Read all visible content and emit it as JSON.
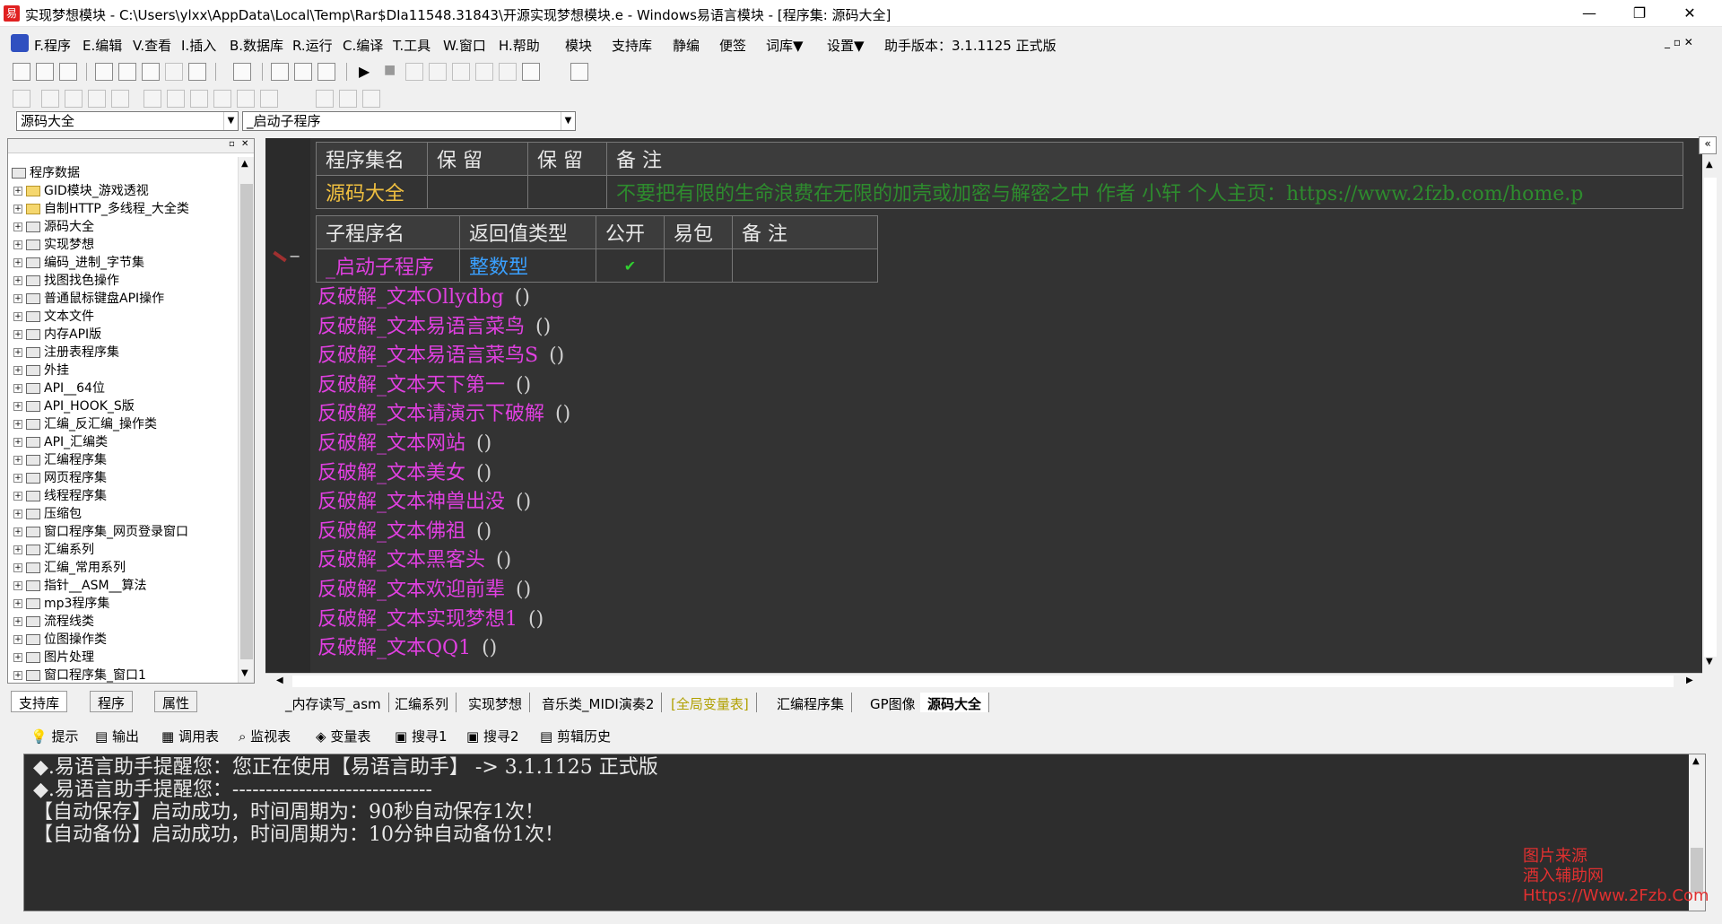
{
  "window": {
    "title": "实现梦想模块 - C:\\Users\\ylxx\\AppData\\Local\\Temp\\Rar$DIa11548.31843\\开源实现梦想模块.e - Windows易语言模块 - [程序集: 源码大全]"
  },
  "menu": [
    "F.程序",
    "E.编辑",
    "V.查看",
    "I.插入",
    "B.数据库",
    "R.运行",
    "C.编译",
    "T.工具",
    "W.窗口",
    "H.帮助",
    "模块",
    "支持库",
    "静编",
    "便签",
    "词库▼",
    "设置▼",
    "助手版本：3.1.1125 正式版"
  ],
  "combos": {
    "left": "源码大全",
    "right": "_启动子程序"
  },
  "tree": {
    "root": "程序数据",
    "items": [
      "GID模块_游戏透视",
      "自制HTTP_多线程_大全类",
      "源码大全",
      "实现梦想",
      "编码_进制_字节集",
      "找图找色操作",
      "普通鼠标键盘API操作",
      "文本文件",
      "内存API版",
      "注册表程序集",
      "外挂",
      "API__64位",
      "API_HOOK_S版",
      "汇编_反汇编_操作类",
      "API_汇编类",
      "汇编程序集",
      "网页程序集",
      "线程程序集",
      "压缩包",
      "窗口程序集_网页登录窗口",
      "汇编系列",
      "汇编_常用系列",
      "指针__ASM__算法",
      "mp3程序集",
      "流程线类",
      "位图操作类",
      "图片处理",
      "窗口程序集_窗口1"
    ]
  },
  "left_tabs": [
    "支持库",
    "程序",
    "属性"
  ],
  "assembly_table": {
    "headers": [
      "程序集名",
      "保 留",
      "保 留",
      "备 注"
    ],
    "row": [
      "源码大全",
      "",
      "",
      "不要把有限的生命浪费在无限的加壳或加密与解密之中  作者 小轩 个人主页：https://www.2fzb.com/home.p"
    ]
  },
  "sub_table": {
    "headers": [
      "子程序名",
      "返回值类型",
      "公开",
      "易包",
      "备 注"
    ],
    "row": [
      "_启动子程序",
      "整数型",
      "✔",
      "",
      ""
    ]
  },
  "code_lines": [
    "反破解_文本Ollydbg",
    "反破解_文本易语言菜鸟",
    "反破解_文本易语言菜鸟S",
    "反破解_文本天下第一",
    "反破解_文本请演示下破解",
    "反破解_文本网站",
    "反破解_文本美女",
    "反破解_文本神兽出没",
    "反破解_文本佛祖",
    "反破解_文本黑客头",
    "反破解_文本欢迎前辈",
    "反破解_文本实现梦想1",
    "反破解_文本QQ1"
  ],
  "paren": "()",
  "doc_tabs": [
    "_内存读写_asm",
    "汇编系列",
    "实现梦想",
    "音乐类_MIDI演奏2",
    "[全局变量表]",
    "汇编程序集",
    "GP图像",
    "源码大全"
  ],
  "bottom_tabs": [
    "提示",
    "输出",
    "调用表",
    "监视表",
    "变量表",
    "搜寻1",
    "搜寻2",
    "剪辑历史"
  ],
  "output_lines": [
    "◆.易语言助手提醒您：您正在使用【易语言助手】 -> 3.1.1125 正式版",
    "◆.易语言助手提醒您：------------------------------",
    "【自动保存】启动成功，时间周期为：90秒自动保存1次！",
    "【自动备份】启动成功，时间周期为：10分钟自动备份1次！"
  ],
  "watermark": [
    "图片来源",
    "酒入辅助网",
    "Https://Www.2Fzb.Com"
  ],
  "colors": {
    "keyword": "#e040e0",
    "type": "#3aa0ff",
    "comment": "#2e8b2e",
    "name": "#f0c040"
  }
}
